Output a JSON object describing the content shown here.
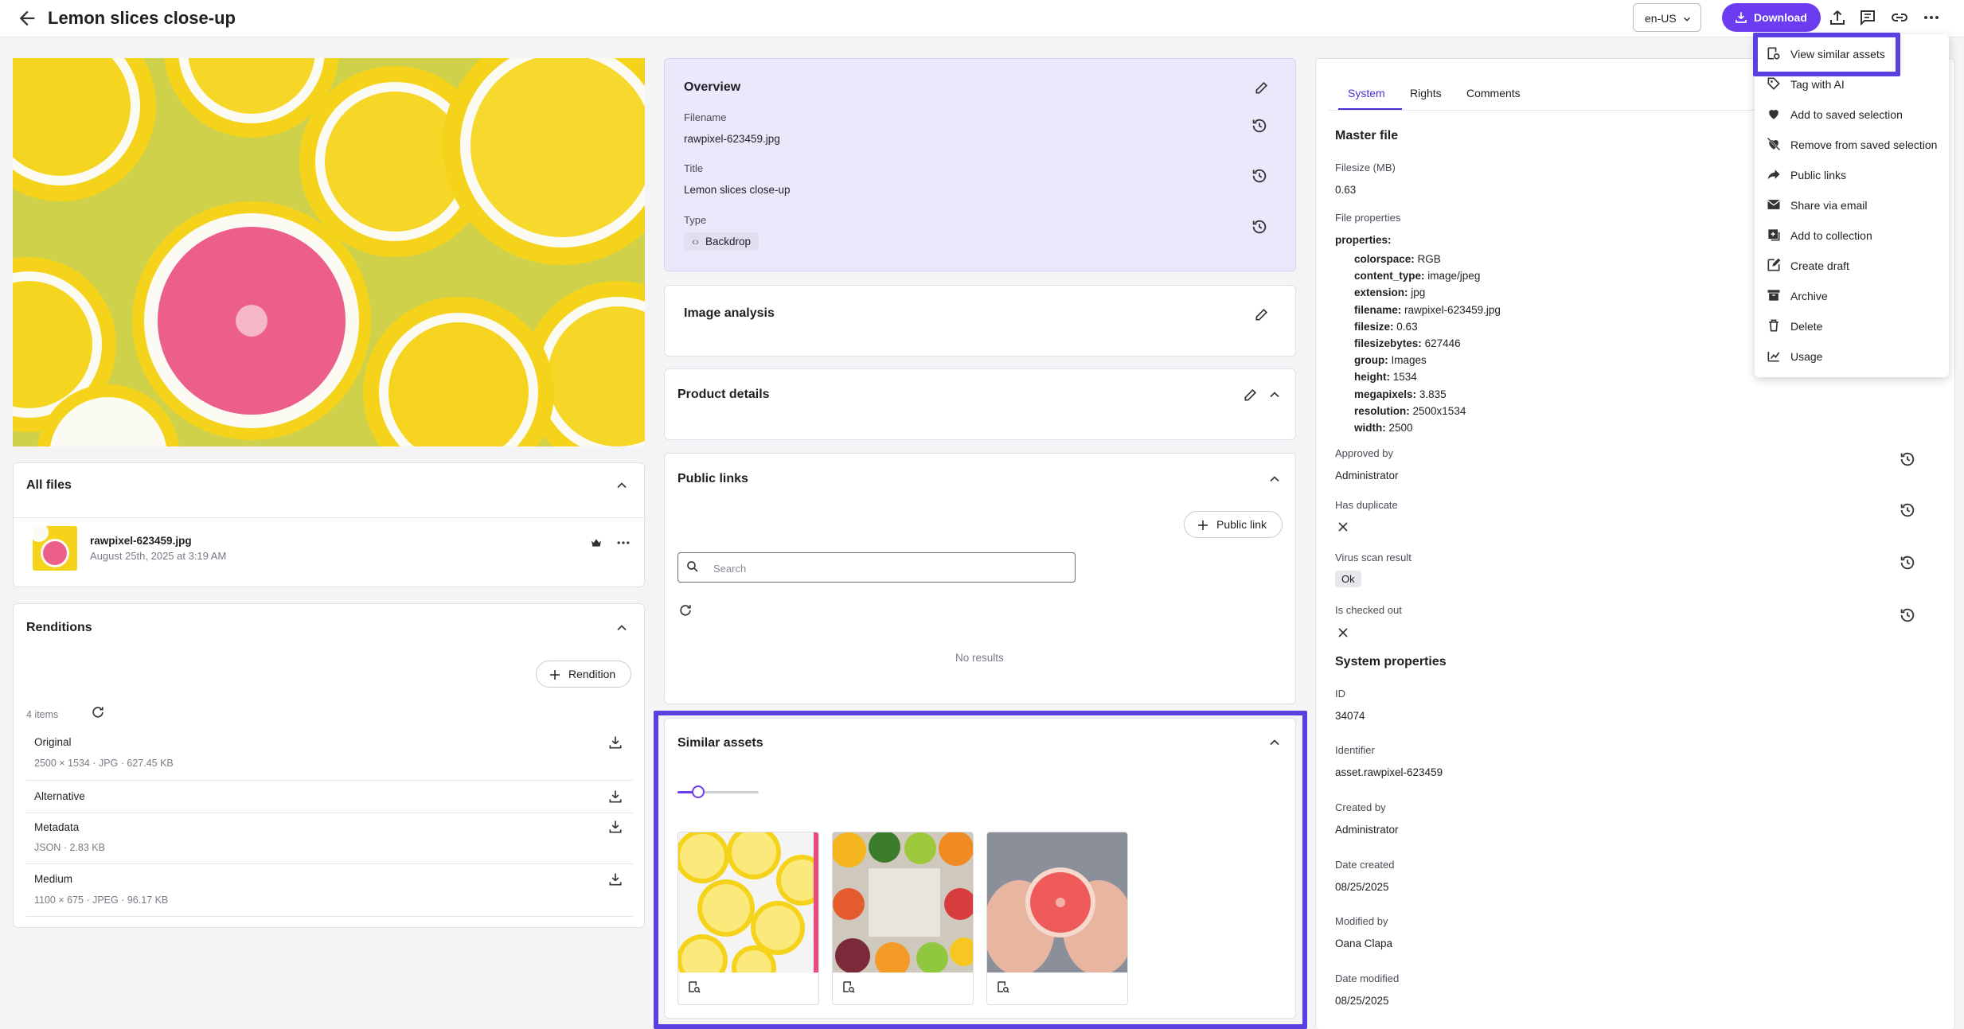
{
  "header": {
    "title": "Lemon slices close-up",
    "language": "en-US",
    "download_label": "Download"
  },
  "all_files": {
    "title": "All files",
    "file_name": "rawpixel-623459.jpg",
    "file_date": "August 25th, 2025 at 3:19 AM"
  },
  "renditions": {
    "title": "Renditions",
    "add_label": "Rendition",
    "count": "4 items",
    "items": [
      {
        "name": "Original",
        "meta": "2500 × 1534 · JPG · 627.45 KB"
      },
      {
        "name": "Alternative",
        "meta": ""
      },
      {
        "name": "Metadata",
        "meta": "JSON · 2.83 KB"
      },
      {
        "name": "Medium",
        "meta": "1100 × 675 · JPEG · 96.17 KB"
      }
    ]
  },
  "overview": {
    "title": "Overview",
    "filename_label": "Filename",
    "filename": "rawpixel-623459.jpg",
    "title_label": "Title",
    "title_value": "Lemon slices close-up",
    "type_label": "Type",
    "type_value": "Backdrop"
  },
  "image_analysis": {
    "title": "Image analysis"
  },
  "product_details": {
    "title": "Product details"
  },
  "public_links": {
    "title": "Public links",
    "add_label": "Public link",
    "search_placeholder": "Search",
    "empty": "No results"
  },
  "similar_assets": {
    "title": "Similar assets",
    "slider_value": 0.25,
    "items": [
      "lemon-slices",
      "mixed-fruit",
      "grapefruit-hands"
    ]
  },
  "system": {
    "tabs": [
      "System",
      "Rights",
      "Comments"
    ],
    "active_tab": "System",
    "master_file": "Master file",
    "filesize_label": "Filesize (MB)",
    "filesize": "0.63",
    "file_props_label": "File properties",
    "props_heading": "properties:",
    "props": [
      {
        "k": "colorspace:",
        "v": "RGB"
      },
      {
        "k": "content_type:",
        "v": "image/jpeg"
      },
      {
        "k": "extension:",
        "v": "jpg"
      },
      {
        "k": "filename:",
        "v": "rawpixel-623459.jpg"
      },
      {
        "k": "filesize:",
        "v": "0.63"
      },
      {
        "k": "filesizebytes:",
        "v": "627446"
      },
      {
        "k": "group:",
        "v": "Images"
      },
      {
        "k": "height:",
        "v": "1534"
      },
      {
        "k": "megapixels:",
        "v": "3.835"
      },
      {
        "k": "resolution:",
        "v": "2500x1534"
      },
      {
        "k": "width:",
        "v": "2500"
      }
    ],
    "approved_label": "Approved by",
    "approved": "Administrator",
    "duplicate_label": "Has duplicate",
    "virus_label": "Virus scan result",
    "virus": "Ok",
    "checked_out_label": "Is checked out",
    "sys_props": "System properties",
    "id_label": "ID",
    "id": "34074",
    "identifier_label": "Identifier",
    "identifier": "asset.rawpixel-623459",
    "created_by_label": "Created by",
    "created_by": "Administrator",
    "date_created_label": "Date created",
    "date_created": "08/25/2025",
    "modified_by_label": "Modified by",
    "modified_by": "Oana Clapa",
    "date_modified_label": "Date modified",
    "date_modified": "08/25/2025"
  },
  "menu": {
    "items": [
      {
        "label": "View similar assets",
        "icon": "image-search-icon"
      },
      {
        "label": "Tag with AI",
        "icon": "ai-tag-icon"
      },
      {
        "label": "Add to saved selection",
        "icon": "heart-icon"
      },
      {
        "label": "Remove from saved selection",
        "icon": "heart-off-icon"
      },
      {
        "label": "Public links",
        "icon": "share-arrow-icon"
      },
      {
        "label": "Share via email",
        "icon": "mail-icon"
      },
      {
        "label": "Add to collection",
        "icon": "collection-add-icon"
      },
      {
        "label": "Create draft",
        "icon": "edit-square-icon"
      },
      {
        "label": "Archive",
        "icon": "archive-icon"
      },
      {
        "label": "Delete",
        "icon": "trash-icon"
      },
      {
        "label": "Usage",
        "icon": "usage-icon"
      }
    ]
  },
  "colors": {
    "accent": "#6c3cf0",
    "highlight": "#5b3fe0",
    "overview_bg": "#ece7fb"
  }
}
